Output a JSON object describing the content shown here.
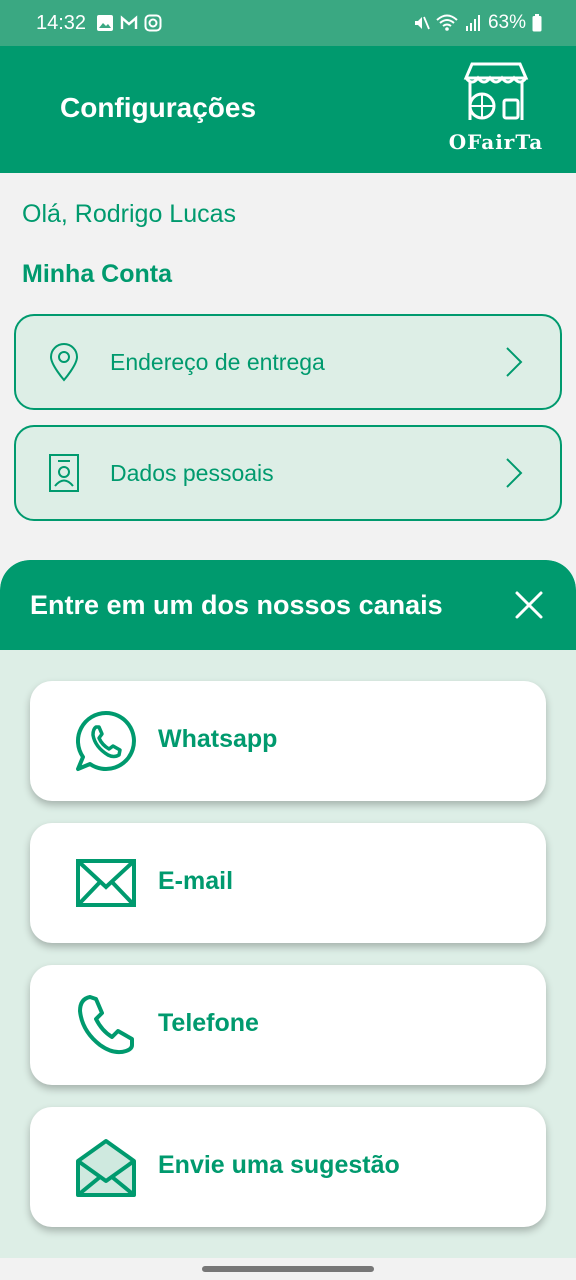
{
  "status_bar": {
    "time": "14:32",
    "battery": "63%"
  },
  "header": {
    "title": "Configurações",
    "logo_text": "OFairTa"
  },
  "greeting": "Olá, Rodrigo Lucas",
  "account": {
    "title": "Minha Conta",
    "items": [
      {
        "label": "Endereço de entrega",
        "icon": "location-pin-icon"
      },
      {
        "label": "Dados pessoais",
        "icon": "id-card-icon"
      }
    ]
  },
  "sheet": {
    "title": "Entre em um dos nossos canais",
    "channels": [
      {
        "label": "Whatsapp",
        "icon": "whatsapp-icon"
      },
      {
        "label": "E-mail",
        "icon": "mail-icon"
      },
      {
        "label": "Telefone",
        "icon": "phone-icon"
      },
      {
        "label": "Envie uma sugestão",
        "icon": "open-envelope-icon"
      }
    ]
  },
  "colors": {
    "primary": "#009a6e",
    "status_bar": "#3aa882",
    "card_bg": "#ddeee6",
    "page_bg": "#f2f2f2"
  }
}
